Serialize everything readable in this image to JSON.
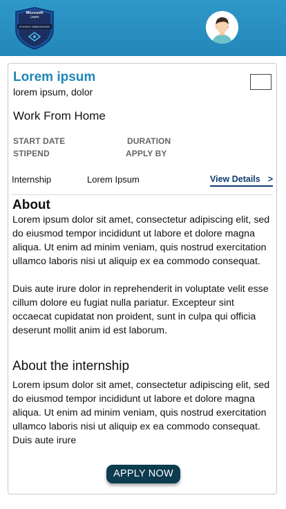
{
  "header": {
    "logo": {
      "line1": "Microsoft",
      "line2": "Learn",
      "line3": "STUDENT AMBASSADOR",
      "icon": "microsoft-learn-student-ambassador-badge"
    },
    "avatar_icon": "user-avatar-icon"
  },
  "job": {
    "title": "Lorem ipsum",
    "company": "lorem ipsum, dolor",
    "location": "Work From Home",
    "labels": {
      "start_date": "START DATE",
      "duration": "DURATION",
      "stipend": "STIPEND",
      "apply_by": "APPLY BY"
    },
    "type": "Internship",
    "type_value": "Lorem Ipsum",
    "view_details": "View Details",
    "view_details_chevron": ">"
  },
  "about": {
    "heading": "About",
    "para1": "Lorem ipsum dolor sit amet, consectetur adipiscing elit, sed do eiusmod tempor incididunt ut labore et dolore magna aliqua. Ut enim ad minim veniam, quis nostrud exercitation ullamco laboris nisi ut aliquip ex ea commodo consequat.",
    "para2": "Duis aute irure dolor in reprehenderit in voluptate velit esse cillum dolore eu fugiat nulla pariatur. Excepteur sint occaecat cupidatat non proident, sunt in culpa qui officia deserunt mollit anim id est laborum."
  },
  "internship": {
    "heading": "About the internship",
    "para": "Lorem ipsum dolor sit amet, consectetur adipiscing elit, sed do eiusmod tempor incididunt ut labore et dolore magna aliqua. Ut enim ad minim veniam, quis nostrud exercitation ullamco laboris nisi ut aliquip ex ea commodo consequat. Duis aute irure"
  },
  "apply_button": "APPLY NOW",
  "colors": {
    "header_bg": "#2387b9",
    "title": "#1f86b5",
    "link": "#0f3c6e",
    "apply_bg": "#0d3b4f"
  }
}
